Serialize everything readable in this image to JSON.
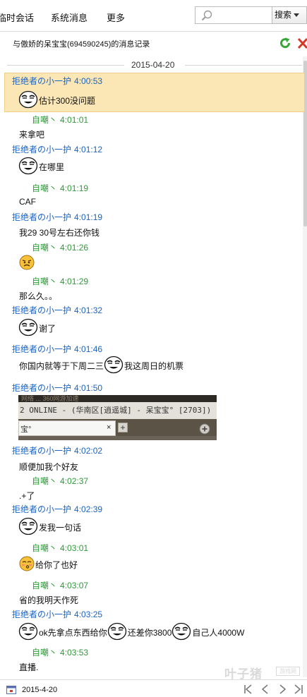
{
  "menu": {
    "temp_chat": "临时会话",
    "system_messages": "系统消息",
    "more": "更多"
  },
  "search": {
    "placeholder": "",
    "button_label": "搜索"
  },
  "header": {
    "title": "与傲娇的呆宝宝(694590245)的消息记录"
  },
  "date_separator": "2015-04-20",
  "entries": [
    {
      "sender": "拒绝者の小一护",
      "time": "4:00:53",
      "role": "friend",
      "text": "估计300没问题",
      "emoji": "face-grin"
    },
    {
      "sender": "自嘲丶",
      "time": "4:01:01",
      "role": "me",
      "text": "来拿吧"
    },
    {
      "sender": "拒绝者の小一护",
      "time": "4:01:12",
      "role": "friend",
      "text": "在哪里",
      "emoji": "face-grin"
    },
    {
      "sender": "自嘲丶",
      "time": "4:01:19",
      "role": "me",
      "text": "CAF"
    },
    {
      "sender": "拒绝者の小一护",
      "time": "4:01:19",
      "role": "friend",
      "text": "我29 30号左右还你钱"
    },
    {
      "sender": "自嘲丶",
      "time": "4:01:26",
      "role": "me",
      "text": "",
      "emoji": "face-disgust"
    },
    {
      "sender": "自嘲丶",
      "time": "4:01:29",
      "role": "me",
      "text": "那么久。。"
    },
    {
      "sender": "拒绝者の小一护",
      "time": "4:01:32",
      "role": "friend",
      "text": "谢了",
      "emoji": "face-grin"
    },
    {
      "sender": "拒绝者の小一护",
      "time": "4:01:46",
      "role": "friend",
      "text_before": "你国内就等于下周二三",
      "text_after": "我这周日的机票",
      "emoji": "face-grin"
    },
    {
      "sender": "拒绝者の小一护",
      "time": "4:01:50",
      "role": "friend",
      "image": {
        "top_text": "网络 ... 360网游加速",
        "bar_text": "2 ONLINE - (华南区[逍遥城] - 呆宝宝° [2703])",
        "tab_label": "宝°",
        "close": "×",
        "plus": "+"
      }
    },
    {
      "sender": "拒绝者の小一护",
      "time": "4:02:02",
      "role": "friend",
      "text": "顺便加我个好友"
    },
    {
      "sender": "自嘲丶",
      "time": "4:02:37",
      "role": "me",
      "text": ".+了"
    },
    {
      "sender": "拒绝者の小一护",
      "time": "4:02:39",
      "role": "friend",
      "text": "发我一句话",
      "emoji": "face-grin"
    },
    {
      "sender": "自嘲丶",
      "time": "4:03:01",
      "role": "me",
      "text": "给你了也好",
      "emoji": "face-kiss"
    },
    {
      "sender": "自嘲丶",
      "time": "4:03:07",
      "role": "me",
      "text": "省的我明天作死"
    },
    {
      "sender": "拒绝者の小一护",
      "time": "4:03:25",
      "role": "friend",
      "segments": [
        "ok先拿点东西给你",
        "还差你3800",
        "自己人4000W"
      ],
      "emoji": "face-grin"
    },
    {
      "sender": "自嘲丶",
      "time": "4:03:53",
      "role": "me",
      "text": "直播."
    }
  ],
  "footer": {
    "date": "2015-4-20"
  },
  "watermark": {
    "name": "叶子猪",
    "box": "游戏网",
    "url": "www.yzz.cn"
  },
  "colors": {
    "friend_name": "#1a63c4",
    "me_name": "#2e9a38",
    "highlight_bg": "#fbe7b6"
  }
}
